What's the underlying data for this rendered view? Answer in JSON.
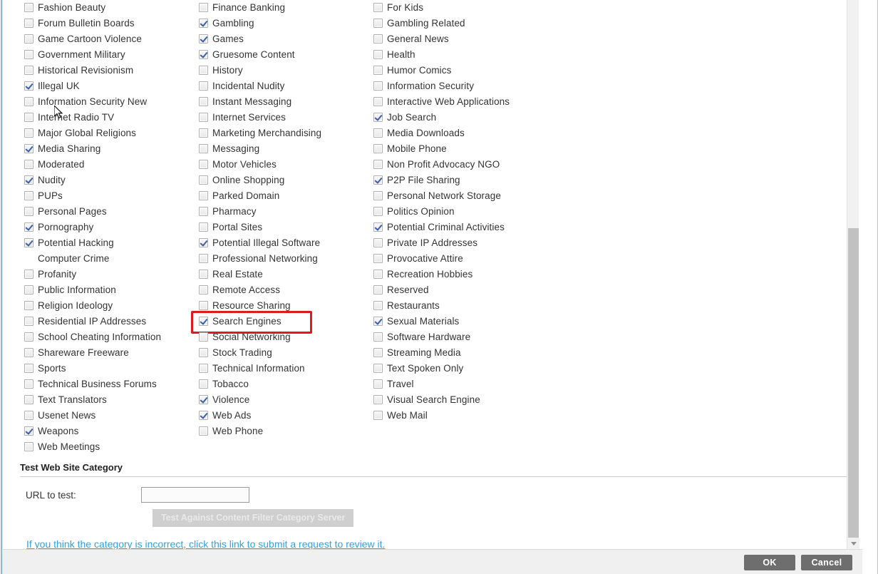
{
  "columns": [
    {
      "id": "col-1",
      "items": [
        {
          "label": "Fashion Beauty",
          "checked": false
        },
        {
          "label": "Forum Bulletin Boards",
          "checked": false
        },
        {
          "label": "Game Cartoon Violence",
          "checked": false
        },
        {
          "label": "Government Military",
          "checked": false
        },
        {
          "label": "Historical Revisionism",
          "checked": false
        },
        {
          "label": "Illegal UK",
          "checked": true
        },
        {
          "label": "Information Security New",
          "checked": false
        },
        {
          "label": "Internet Radio TV",
          "checked": false
        },
        {
          "label": "Major Global Religions",
          "checked": false
        },
        {
          "label": "Media Sharing",
          "checked": true
        },
        {
          "label": "Moderated",
          "checked": false
        },
        {
          "label": "Nudity",
          "checked": true
        },
        {
          "label": "PUPs",
          "checked": false
        },
        {
          "label": "Personal Pages",
          "checked": false
        },
        {
          "label": "Pornography",
          "checked": true
        },
        {
          "label": "Potential Hacking Computer Crime",
          "checked": true,
          "wrap": true
        },
        {
          "label": "Profanity",
          "checked": false
        },
        {
          "label": "Public Information",
          "checked": false
        },
        {
          "label": "Religion Ideology",
          "checked": false
        },
        {
          "label": "Residential IP Addresses",
          "checked": false
        },
        {
          "label": "School Cheating Information",
          "checked": false
        },
        {
          "label": "Shareware Freeware",
          "checked": false
        },
        {
          "label": "Sports",
          "checked": false
        },
        {
          "label": "Technical Business Forums",
          "checked": false
        },
        {
          "label": "Text Translators",
          "checked": false
        },
        {
          "label": "Usenet News",
          "checked": false
        },
        {
          "label": "Weapons",
          "checked": true
        },
        {
          "label": "Web Meetings",
          "checked": false
        }
      ]
    },
    {
      "id": "col-2",
      "items": [
        {
          "label": "Finance Banking",
          "checked": false
        },
        {
          "label": "Gambling",
          "checked": true
        },
        {
          "label": "Games",
          "checked": true
        },
        {
          "label": "Gruesome Content",
          "checked": true
        },
        {
          "label": "History",
          "checked": false
        },
        {
          "label": "Incidental Nudity",
          "checked": false
        },
        {
          "label": "Instant Messaging",
          "checked": false
        },
        {
          "label": "Internet Services",
          "checked": false
        },
        {
          "label": "Marketing Merchandising",
          "checked": false
        },
        {
          "label": "Messaging",
          "checked": false
        },
        {
          "label": "Motor Vehicles",
          "checked": false
        },
        {
          "label": "Online Shopping",
          "checked": false
        },
        {
          "label": "Parked Domain",
          "checked": false
        },
        {
          "label": "Pharmacy",
          "checked": false
        },
        {
          "label": "Portal Sites",
          "checked": false
        },
        {
          "label": "Potential Illegal Software",
          "checked": true
        },
        {
          "label": "Professional Networking",
          "checked": false
        },
        {
          "label": "Real Estate",
          "checked": false
        },
        {
          "label": "Remote Access",
          "checked": false
        },
        {
          "label": "Resource Sharing",
          "checked": false
        },
        {
          "label": "Search Engines",
          "checked": true,
          "highlight": true
        },
        {
          "label": "Social Networking",
          "checked": false
        },
        {
          "label": "Stock Trading",
          "checked": false
        },
        {
          "label": "Technical Information",
          "checked": false
        },
        {
          "label": "Tobacco",
          "checked": false
        },
        {
          "label": "Violence",
          "checked": true
        },
        {
          "label": "Web Ads",
          "checked": true
        },
        {
          "label": "Web Phone",
          "checked": false
        }
      ]
    },
    {
      "id": "col-3",
      "items": [
        {
          "label": "For Kids",
          "checked": false
        },
        {
          "label": "Gambling Related",
          "checked": false
        },
        {
          "label": "General News",
          "checked": false
        },
        {
          "label": "Health",
          "checked": false
        },
        {
          "label": "Humor Comics",
          "checked": false
        },
        {
          "label": "Information Security",
          "checked": false
        },
        {
          "label": "Interactive Web Applications",
          "checked": false
        },
        {
          "label": "Job Search",
          "checked": true
        },
        {
          "label": "Media Downloads",
          "checked": false
        },
        {
          "label": "Mobile Phone",
          "checked": false
        },
        {
          "label": "Non Profit Advocacy NGO",
          "checked": false
        },
        {
          "label": "P2P File Sharing",
          "checked": true
        },
        {
          "label": "Personal Network Storage",
          "checked": false
        },
        {
          "label": "Politics Opinion",
          "checked": false
        },
        {
          "label": "Potential Criminal Activities",
          "checked": true
        },
        {
          "label": "Private IP Addresses",
          "checked": false
        },
        {
          "label": "Provocative Attire",
          "checked": false
        },
        {
          "label": "Recreation Hobbies",
          "checked": false
        },
        {
          "label": "Reserved",
          "checked": false
        },
        {
          "label": "Restaurants",
          "checked": false
        },
        {
          "label": "Sexual Materials",
          "checked": true
        },
        {
          "label": "Software Hardware",
          "checked": false
        },
        {
          "label": "Streaming Media",
          "checked": false
        },
        {
          "label": "Text Spoken Only",
          "checked": false
        },
        {
          "label": "Travel",
          "checked": false
        },
        {
          "label": "Visual Search Engine",
          "checked": false
        },
        {
          "label": "Web Mail",
          "checked": false
        }
      ]
    }
  ],
  "test_section": {
    "title": "Test Web Site Category",
    "url_label": "URL to test:",
    "url_value": "",
    "url_placeholder": "",
    "test_button_label": "Test Against Content Filter Category Server",
    "test_button_disabled": true,
    "review_link_text": "If you think the category is incorrect, click this link to submit a request to review it."
  },
  "footer": {
    "ok_label": "OK",
    "cancel_label": "Cancel"
  },
  "scrollbar": {
    "down_arrow_icon": "chevron-down-icon"
  },
  "colors": {
    "highlight_border": "#e01b1b",
    "link": "#2ca3e0",
    "button_bg": "#6e6e6e",
    "check_mark": "#3b5fa8"
  }
}
